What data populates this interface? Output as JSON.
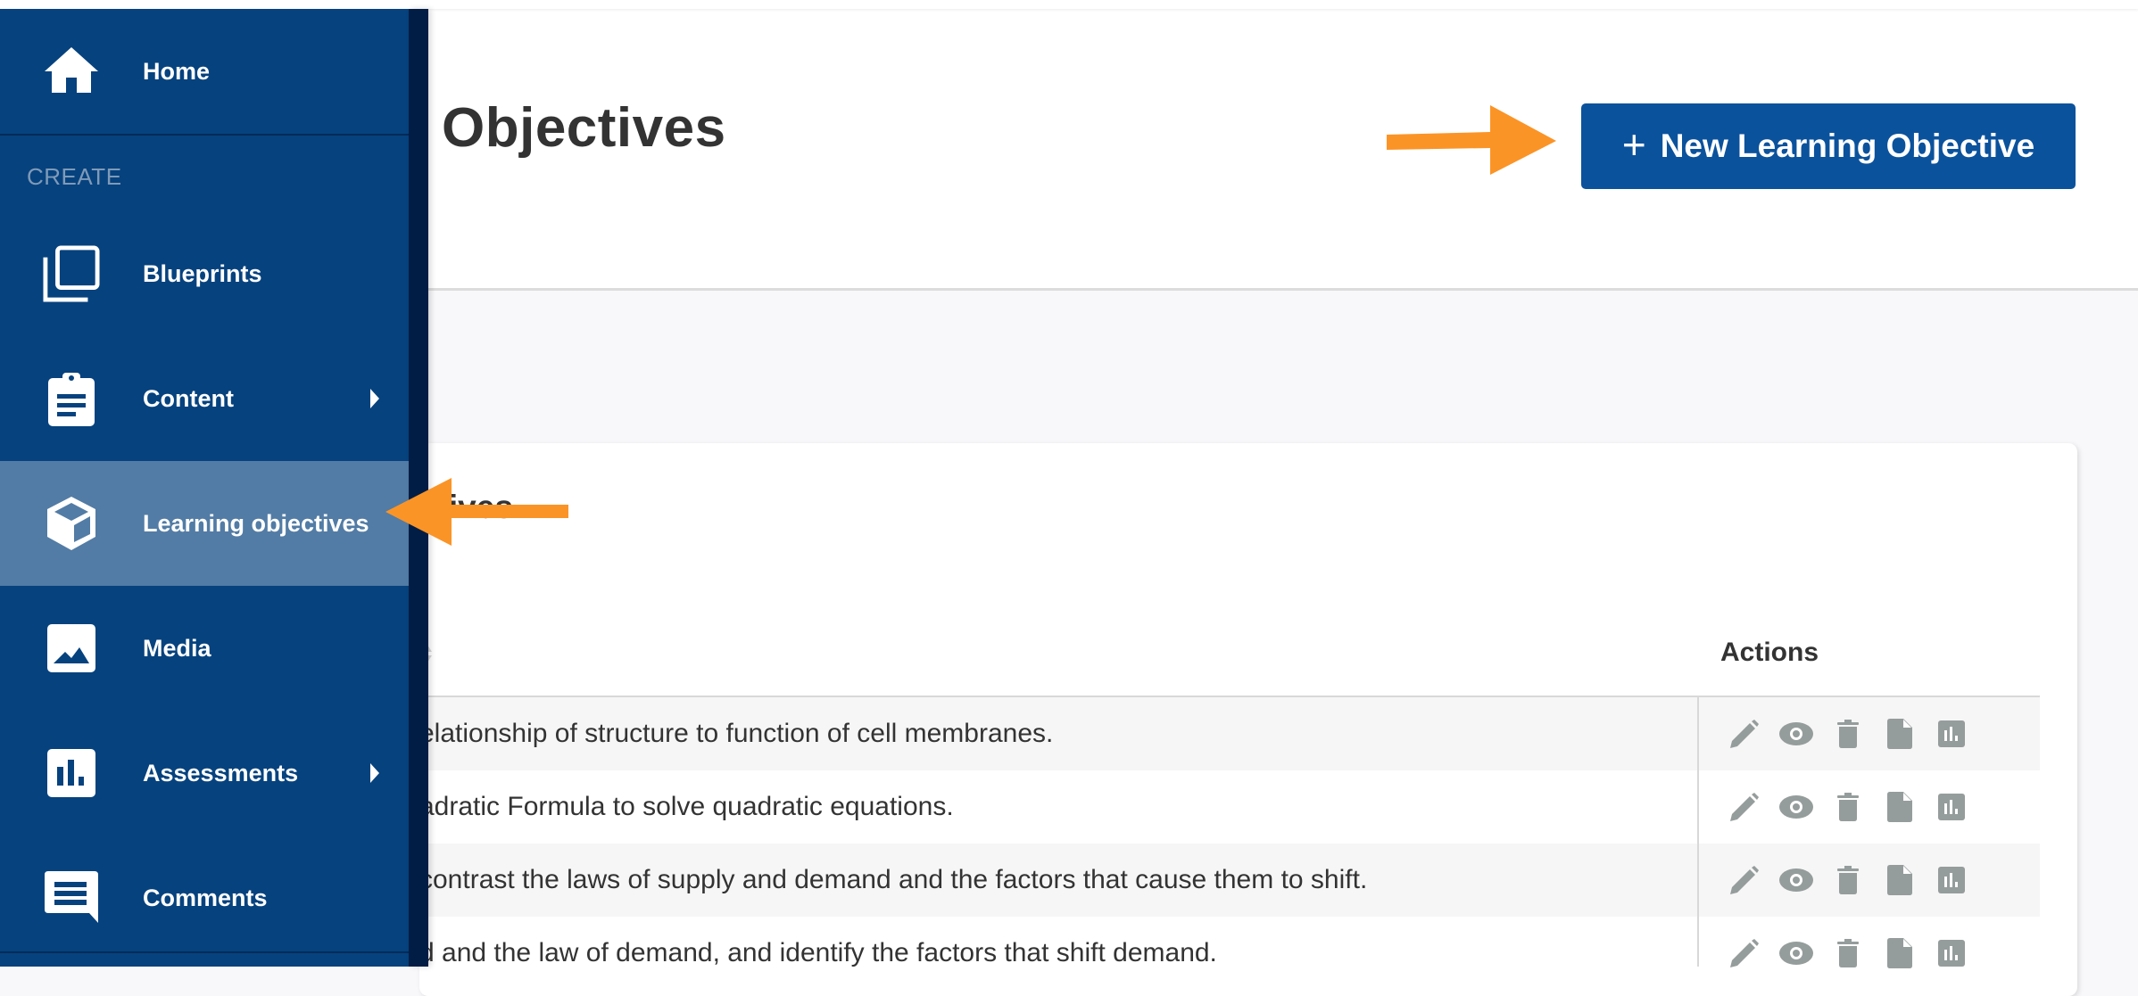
{
  "header": {
    "title_visible": "Objectives",
    "new_button": {
      "icon": "plus-icon",
      "label": "New Learning Objective"
    }
  },
  "sidebar": {
    "home": {
      "label": "Home",
      "icon": "home-icon"
    },
    "section_label": "CREATE",
    "items": [
      {
        "label": "Blueprints",
        "icon": "copy-stack-icon",
        "has_submenu": false,
        "active": false
      },
      {
        "label": "Content",
        "icon": "clipboard-icon",
        "has_submenu": true,
        "active": false
      },
      {
        "label": "Learning objectives",
        "icon": "cube-icon",
        "has_submenu": false,
        "active": true
      },
      {
        "label": "Media",
        "icon": "image-icon",
        "has_submenu": false,
        "active": false
      },
      {
        "label": "Assessments",
        "icon": "bar-chart-icon",
        "has_submenu": true,
        "active": false
      },
      {
        "label": "Comments",
        "icon": "comment-icon",
        "has_submenu": false,
        "active": false
      }
    ]
  },
  "card": {
    "title_visible": "ctives",
    "columns": {
      "actions": "Actions"
    },
    "rows": [
      {
        "text": "elationship of structure to function of cell membranes."
      },
      {
        "text": "adratic Formula to solve quadratic equations."
      },
      {
        "text": " contrast the laws of supply and demand and the factors that cause them to shift."
      },
      {
        "text": "d and the law of demand, and identify the factors that shift demand."
      }
    ],
    "row_actions": [
      "edit-icon",
      "view-icon",
      "delete-icon",
      "document-icon",
      "report-icon"
    ]
  },
  "annotations": {
    "arrow_color": "#fb9426",
    "arrows": [
      "points-to-new-learning-objective-button",
      "points-to-learning-objectives-nav"
    ]
  },
  "colors": {
    "sidebar_bg": "#06427e",
    "sidebar_active": "#527ca5",
    "primary_button": "#0b529c",
    "icon_gray": "#959c9c"
  }
}
